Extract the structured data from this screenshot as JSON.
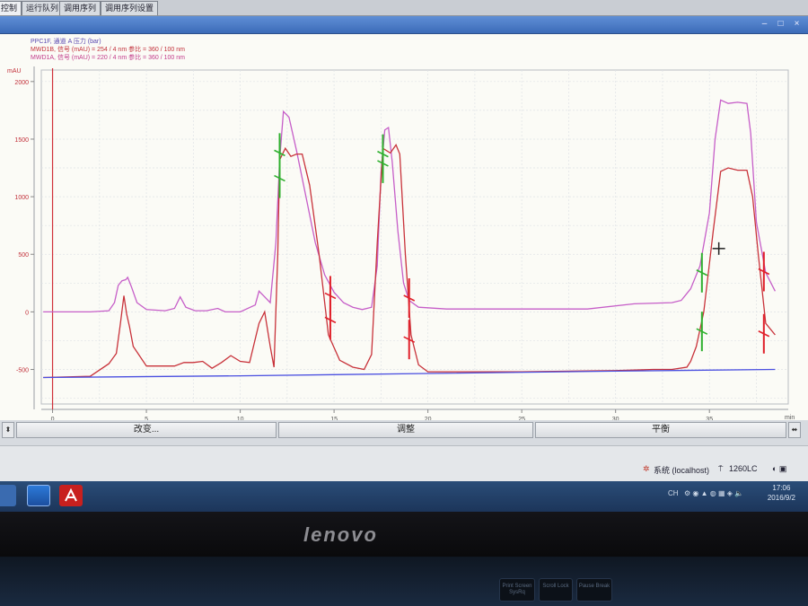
{
  "tabs": [
    {
      "label": "控制",
      "active": true
    },
    {
      "label": "运行队列",
      "active": false
    },
    {
      "label": "调用序列",
      "active": false
    },
    {
      "label": "调用序列设置",
      "active": false
    }
  ],
  "legend": [
    {
      "text": "PPC1F, 通道 A 压力 (bar)",
      "color": "#5b4ab0"
    },
    {
      "text": "MWD1B, 信号 (mAU) = 254 / 4 nm 参比 = 360 / 100 nm",
      "color": "#c2303a"
    },
    {
      "text": "MWD1A, 信号 (mAU) = 220 / 4 nm 参比 = 360 / 100 nm",
      "color": "#c23a8a"
    }
  ],
  "buttons": {
    "change": "改变...",
    "adjust": "调整",
    "balance": "平衡"
  },
  "status": {
    "system": "系统 (localhost)",
    "instrument": "1260LC"
  },
  "clock": {
    "time": "17:06",
    "date": "2016/9/2"
  },
  "brand": "lenovo",
  "keyboard": {
    "key1": "Print Screen SysRq",
    "key2": "Scroll Lock",
    "key3": "Pause Break"
  },
  "colors": {
    "magenta_trace": "#c65ec8",
    "red_trace": "#c8323a",
    "baseline": "#4a4fe0",
    "marker_red": "#e0202a",
    "marker_green": "#2fb02f"
  },
  "chart_data": {
    "type": "line",
    "ylabel": "mAU",
    "xlabel": "min",
    "xlim": [
      -0.6,
      39.2
    ],
    "ylim": [
      -800,
      2100
    ],
    "yticks": [
      -500,
      0,
      500,
      1000,
      1500,
      2000
    ],
    "xticks": [
      0,
      5,
      10,
      15,
      20,
      25,
      30,
      35
    ],
    "grid": true,
    "series": [
      {
        "name": "MWD1A",
        "color": "#c65ec8",
        "points": [
          [
            -0.5,
            0
          ],
          [
            2,
            0
          ],
          [
            3,
            10
          ],
          [
            3.3,
            80
          ],
          [
            3.5,
            230
          ],
          [
            3.7,
            270
          ],
          [
            3.9,
            280
          ],
          [
            4,
            300
          ],
          [
            4.2,
            220
          ],
          [
            4.5,
            80
          ],
          [
            5,
            20
          ],
          [
            6,
            10
          ],
          [
            6.5,
            30
          ],
          [
            6.8,
            130
          ],
          [
            7.1,
            40
          ],
          [
            7.6,
            10
          ],
          [
            8.2,
            10
          ],
          [
            8.8,
            30
          ],
          [
            9.2,
            0
          ],
          [
            10,
            0
          ],
          [
            10.8,
            60
          ],
          [
            11,
            180
          ],
          [
            11.3,
            130
          ],
          [
            11.6,
            80
          ],
          [
            11.9,
            600
          ],
          [
            12.1,
            1320
          ],
          [
            12.3,
            1740
          ],
          [
            12.6,
            1690
          ],
          [
            13,
            1400
          ],
          [
            13.5,
            1000
          ],
          [
            14,
            600
          ],
          [
            14.5,
            320
          ],
          [
            15,
            170
          ],
          [
            15.5,
            80
          ],
          [
            16,
            40
          ],
          [
            16.5,
            20
          ],
          [
            17,
            40
          ],
          [
            17.3,
            400
          ],
          [
            17.5,
            1210
          ],
          [
            17.7,
            1580
          ],
          [
            17.9,
            1600
          ],
          [
            18.1,
            1300
          ],
          [
            18.4,
            700
          ],
          [
            18.7,
            250
          ],
          [
            19,
            100
          ],
          [
            19.5,
            40
          ],
          [
            21,
            25
          ],
          [
            23,
            25
          ],
          [
            25,
            25
          ],
          [
            27,
            25
          ],
          [
            28.5,
            25
          ],
          [
            31,
            70
          ],
          [
            33,
            80
          ],
          [
            33.5,
            100
          ],
          [
            34,
            200
          ],
          [
            34.5,
            400
          ],
          [
            35,
            860
          ],
          [
            35.3,
            1500
          ],
          [
            35.6,
            1840
          ],
          [
            36,
            1810
          ],
          [
            36.5,
            1820
          ],
          [
            37,
            1810
          ],
          [
            37.2,
            1550
          ],
          [
            37.5,
            780
          ],
          [
            38,
            340
          ],
          [
            38.5,
            180
          ]
        ]
      },
      {
        "name": "MWD1B",
        "color": "#c8323a",
        "points": [
          [
            -0.5,
            -570
          ],
          [
            2,
            -560
          ],
          [
            3,
            -450
          ],
          [
            3.4,
            -360
          ],
          [
            3.6,
            -120
          ],
          [
            3.8,
            140
          ],
          [
            3.95,
            -20
          ],
          [
            4.1,
            -130
          ],
          [
            4.3,
            -300
          ],
          [
            5,
            -470
          ],
          [
            6,
            -470
          ],
          [
            6.5,
            -470
          ],
          [
            7,
            -440
          ],
          [
            7.5,
            -440
          ],
          [
            8,
            -430
          ],
          [
            8.5,
            -490
          ],
          [
            9,
            -440
          ],
          [
            9.5,
            -380
          ],
          [
            10,
            -430
          ],
          [
            10.5,
            -440
          ],
          [
            11,
            -100
          ],
          [
            11.3,
            0
          ],
          [
            11.6,
            -300
          ],
          [
            11.8,
            -480
          ],
          [
            12,
            500
          ],
          [
            12.1,
            1320
          ],
          [
            12.4,
            1420
          ],
          [
            12.7,
            1350
          ],
          [
            13,
            1370
          ],
          [
            13.3,
            1370
          ],
          [
            13.7,
            1100
          ],
          [
            14.2,
            500
          ],
          [
            14.7,
            -200
          ],
          [
            15.3,
            -420
          ],
          [
            16,
            -480
          ],
          [
            16.6,
            -500
          ],
          [
            17,
            -370
          ],
          [
            17.3,
            600
          ],
          [
            17.6,
            1420
          ],
          [
            18.0,
            1380
          ],
          [
            18.3,
            1450
          ],
          [
            18.5,
            1370
          ],
          [
            18.8,
            500
          ],
          [
            19.1,
            -200
          ],
          [
            19.5,
            -460
          ],
          [
            20,
            -520
          ],
          [
            25,
            -520
          ],
          [
            30,
            -510
          ],
          [
            32,
            -500
          ],
          [
            33,
            -500
          ],
          [
            33.8,
            -480
          ],
          [
            34,
            -430
          ],
          [
            34.3,
            -300
          ],
          [
            34.7,
            0
          ],
          [
            35.2,
            700
          ],
          [
            35.6,
            1220
          ],
          [
            36,
            1250
          ],
          [
            36.5,
            1230
          ],
          [
            37,
            1230
          ],
          [
            37.3,
            1000
          ],
          [
            37.6,
            500
          ],
          [
            38,
            -100
          ],
          [
            38.5,
            -200
          ]
        ]
      },
      {
        "name": "PPC1F",
        "color": "#4a4fe0",
        "points": [
          [
            -0.5,
            -570
          ],
          [
            10,
            -555
          ],
          [
            20,
            -535
          ],
          [
            30,
            -515
          ],
          [
            38.5,
            -500
          ]
        ]
      }
    ],
    "markers": [
      {
        "x": 12.1,
        "series": "MWD1A",
        "y": 1380,
        "color": "green"
      },
      {
        "x": 12.1,
        "series": "MWD1B",
        "y": 1160,
        "color": "green"
      },
      {
        "x": 14.8,
        "series": "MWD1A",
        "y": 140,
        "color": "red"
      },
      {
        "x": 14.8,
        "series": "MWD1B",
        "y": -70,
        "color": "red"
      },
      {
        "x": 17.6,
        "series": "MWD1A",
        "y": 1370,
        "color": "green"
      },
      {
        "x": 17.6,
        "series": "MWD1B",
        "y": 1290,
        "color": "green"
      },
      {
        "x": 19.0,
        "series": "MWD1A",
        "y": 120,
        "color": "red"
      },
      {
        "x": 19.0,
        "series": "MWD1B",
        "y": -240,
        "color": "red"
      },
      {
        "x": 34.6,
        "series": "MWD1A",
        "y": 340,
        "color": "green"
      },
      {
        "x": 34.6,
        "series": "MWD1B",
        "y": -170,
        "color": "green"
      },
      {
        "x": 37.9,
        "series": "MWD1A",
        "y": 350,
        "color": "red"
      },
      {
        "x": 37.9,
        "series": "MWD1B",
        "y": -190,
        "color": "red"
      }
    ]
  }
}
